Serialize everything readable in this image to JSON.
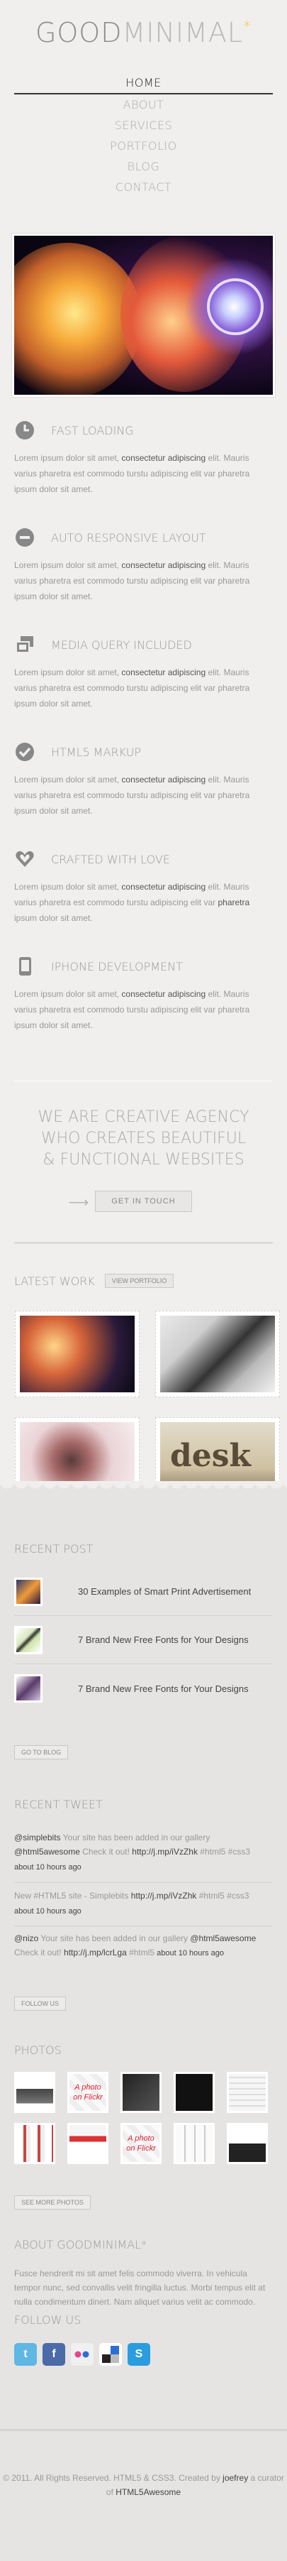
{
  "logo": {
    "part1": "GOOD",
    "part2": "MINIMAL",
    "star": "*"
  },
  "nav": [
    {
      "label": "HOME",
      "active": true
    },
    {
      "label": "ABOUT"
    },
    {
      "label": "SERVICES"
    },
    {
      "label": "PORTFOLIO"
    },
    {
      "label": "BLOG"
    },
    {
      "label": "CONTACT"
    }
  ],
  "features": [
    {
      "icon": "clock-icon",
      "title": "FAST LOADING",
      "text_a": "Lorem ipsum dolor sit amet, ",
      "text_b": "consectetur adipiscing",
      "text_c": " elit. Mauris varius pharetra est commodo turstu adipiscing elit var pharetra ipsum dolor sit amet."
    },
    {
      "icon": "minus-circle-icon",
      "title": "AUTO RESPONSIVE LAYOUT",
      "text_a": "Lorem ipsum dolor sit amet, ",
      "text_b": "consectetur adipiscing",
      "text_c": " elit. Mauris varius pharetra est commodo turstu adipiscing elit var pharetra ipsum dolor sit amet."
    },
    {
      "icon": "windows-icon",
      "title": "MEDIA QUERY INCLUDED",
      "text_a": "Lorem ipsum dolor sit amet, ",
      "text_b": "consectetur adipiscing",
      "text_c": " elit. Mauris varius pharetra est commodo turstu adipiscing elit var pharetra ipsum dolor sit amet."
    },
    {
      "icon": "check-circle-icon",
      "title": "HTML5 MARKUP",
      "text_a": "Lorem ipsum dolor sit amet, ",
      "text_b": "consectetur adipiscing",
      "text_c": " elit. Mauris varius pharetra est commodo turstu adipiscing elit var pharetra ipsum dolor sit amet."
    },
    {
      "icon": "heart-icon",
      "title": "CRAFTED WITH LOVE",
      "text_a": "Lorem ipsum dolor sit amet, ",
      "text_b": "consectetur adipiscing",
      "text_c": " elit. Mauris varius pharetra est commodo turstu adipiscing elit var ",
      "text_d": "pharetra",
      "text_e": " ipsum dolor sit amet."
    },
    {
      "icon": "phone-icon",
      "title": "IPHONE DEVELOPMENT",
      "text_a": "Lorem ipsum dolor sit amet, ",
      "text_b": "consectetur adipiscing",
      "text_c": " elit. Mauris varius pharetra est commodo turstu adipiscing elit var pharetra ipsum dolor sit amet."
    }
  ],
  "slogan": "WE ARE CREATIVE AGENCY WHO CREATES BEAUTIFUL & FUNCTIONAL WEBSITES",
  "cta_label": "GET IN TOUCH",
  "latest_work": {
    "title": "LATEST WORK",
    "button": "VIEW PORTFOLIO",
    "desk_text": "desk"
  },
  "recent_post": {
    "title": "RECENT POST",
    "items": [
      "30 Examples of Smart Print Advertisement",
      "7 Brand New Free Fonts for Your Designs",
      "7 Brand New Free Fonts for Your Designs"
    ],
    "button": "GO TO BLOG"
  },
  "recent_tweet": {
    "title": "RECENT TWEET",
    "tweets": [
      {
        "user": "@simplebits",
        "text1": " Your site has been added in our gallery ",
        "user2": "@html5awesome",
        "text2": " Check it out! ",
        "link": "http://j.mp/iVzZhk",
        "tag": " #html5 #css3",
        "time": " about 10 hours ago"
      },
      {
        "pre": "New #HTML5 site - Simplebits ",
        "link": "http://j.mp/iVzZhk",
        "tag": " #html5 #css3",
        "time": " about 10 hours ago"
      },
      {
        "user": "@nizo",
        "text1": " Your site has been added in our gallery ",
        "user2": "@html5awesome",
        "text2": " Check it out! ",
        "link": "http://j.mp/lcrLga",
        "tag": " #html5",
        "time": " about 10 hours ago"
      }
    ],
    "button": "FOLLOW US"
  },
  "photos": {
    "title": "PHOTOS",
    "flickr_text": "A photo on Flickr",
    "button": "SEE MORE PHOTOS"
  },
  "about": {
    "title": "ABOUT GOODMINIMAL*",
    "text": "Fusce hendrerit mi sit amet felis commodo viverra. In vehicula tempor nunc, sed convallis velit fringilla luctus. Morbi tempus elit at nulla condimentum dinert. Nam aliquet varius velit ac commodo."
  },
  "follow": {
    "title": "FOLLOW US"
  },
  "copyright": {
    "text1": "© 2011. All Rights Reserved. HTML5 & CSS3. Created by ",
    "author": "joefrey",
    "text2": " a curator of ",
    "site": "HTML5Awesome"
  },
  "colors": {
    "accent_star": "#f2c21b",
    "background": "#f0efed",
    "footer_bg": "#e5e4e2",
    "text": "#999999",
    "flickr_red": "#dd2233"
  }
}
